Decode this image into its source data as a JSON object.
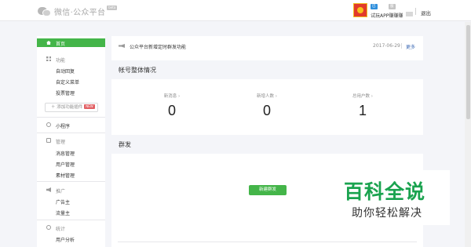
{
  "header": {
    "brand": "微信·公众平台",
    "beta_badge": "beta",
    "account": {
      "verified_tag": "已认证",
      "type_tag": "服务号",
      "name": "试玩APP赚赚赚"
    },
    "logout": "退出"
  },
  "sidebar": {
    "home": "首页",
    "groups": [
      {
        "title": "功能",
        "icon": "grid-icon",
        "items": [
          "自动回复",
          "自定义菜单",
          "投票管理"
        ]
      },
      {
        "title": "小程序",
        "icon": "link-icon",
        "items": []
      },
      {
        "title": "管理",
        "icon": "box-icon",
        "items": [
          "消息管理",
          "用户管理",
          "素材管理"
        ]
      },
      {
        "title": "推广",
        "icon": "speaker-icon",
        "items": [
          "广告主",
          "流量主"
        ]
      },
      {
        "title": "统计",
        "icon": "clock-icon",
        "items": [
          "用户分析"
        ]
      }
    ],
    "add_plugin": "＋ 添加功能插件",
    "add_plugin_badge": "NEW"
  },
  "notice": {
    "text": "公众平台新增定时群发功能",
    "date": "2017-06-29",
    "more": "更多"
  },
  "overview": {
    "title": "帐号整体情况",
    "stats": [
      {
        "label": "新消息 ›",
        "value": "0"
      },
      {
        "label": "新增人数 ›",
        "value": "0"
      },
      {
        "label": "总用户数 ›",
        "value": "1"
      }
    ]
  },
  "broadcast": {
    "title": "群发",
    "button": "新建群发"
  },
  "watermark": {
    "big": "百科全说",
    "small": "助你轻松解决"
  },
  "colors": {
    "accent": "#44b549",
    "link": "#3e6bb5",
    "watermark_green": "#1aa34f"
  }
}
